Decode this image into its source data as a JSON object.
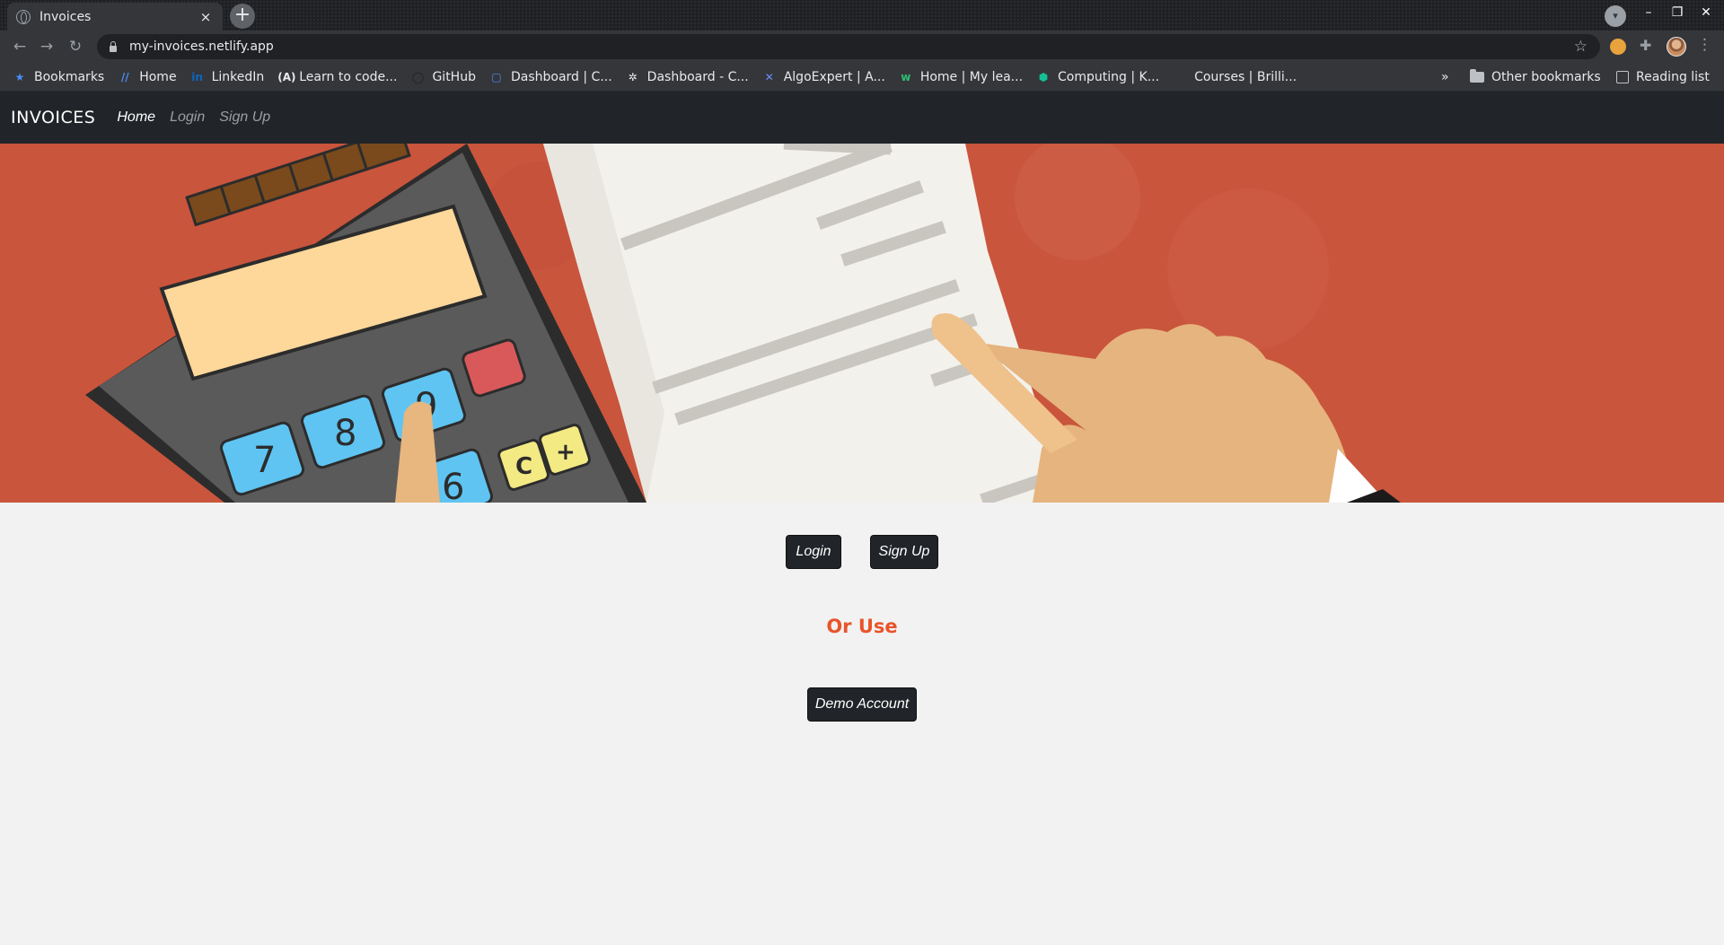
{
  "browser": {
    "tab_title": "Invoices",
    "tab_close": "×",
    "new_tab": "+",
    "url": "my-invoices.netlify.app",
    "bookmarks": [
      {
        "label": "Bookmarks",
        "icon": "star-icon",
        "glyph": "★",
        "color": "#4a8df8"
      },
      {
        "label": "Home",
        "icon": "slash-logo-icon",
        "glyph": "//",
        "color": "#4a8df8"
      },
      {
        "label": "LinkedIn",
        "icon": "linkedin-icon",
        "glyph": "in",
        "color": "#0a66c2"
      },
      {
        "label": "Learn to code...",
        "icon": "freecodecamp-icon",
        "glyph": "(A)",
        "color": "#e8eaed"
      },
      {
        "label": "GitHub",
        "icon": "github-icon",
        "glyph": "◯",
        "color": "#202124"
      },
      {
        "label": "Dashboard | C...",
        "icon": "dashboard-icon",
        "glyph": "▢",
        "color": "#4a8df8"
      },
      {
        "label": "Dashboard - C...",
        "icon": "codewars-icon",
        "glyph": "✲",
        "color": "#e8eaed"
      },
      {
        "label": "AlgoExpert | A...",
        "icon": "algoexpert-icon",
        "glyph": "✕",
        "color": "#6b8dff"
      },
      {
        "label": "Home | My lea...",
        "icon": "wiki-icon",
        "glyph": "w",
        "color": "#2fbf71"
      },
      {
        "label": "Computing | K...",
        "icon": "khan-icon",
        "glyph": "⬢",
        "color": "#14bf96"
      },
      {
        "label": "Courses | Brilli...",
        "icon": "brilliant-icon",
        "glyph": "",
        "color": "#35363a"
      }
    ],
    "bookmarks_overflow": "»",
    "other_bookmarks": "Other bookmarks",
    "reading_list": "Reading list"
  },
  "app": {
    "brand": "INVOICES",
    "nav": [
      {
        "label": "Home",
        "active": true
      },
      {
        "label": "Login",
        "active": false
      },
      {
        "label": "Sign Up",
        "active": false
      }
    ],
    "hero_icon": "calculator-invoice-illustration",
    "calculator_keys": [
      "7",
      "8",
      "9",
      "6",
      "C",
      "+"
    ],
    "buttons": {
      "login": "Login",
      "signup": "Sign Up",
      "demo": "Demo Account"
    },
    "or_use": "Or Use",
    "colors": {
      "navbar": "#212529",
      "accent": "#e8542b",
      "hero_bg": "#c9553c",
      "page_bg": "#f2f2f2"
    }
  }
}
